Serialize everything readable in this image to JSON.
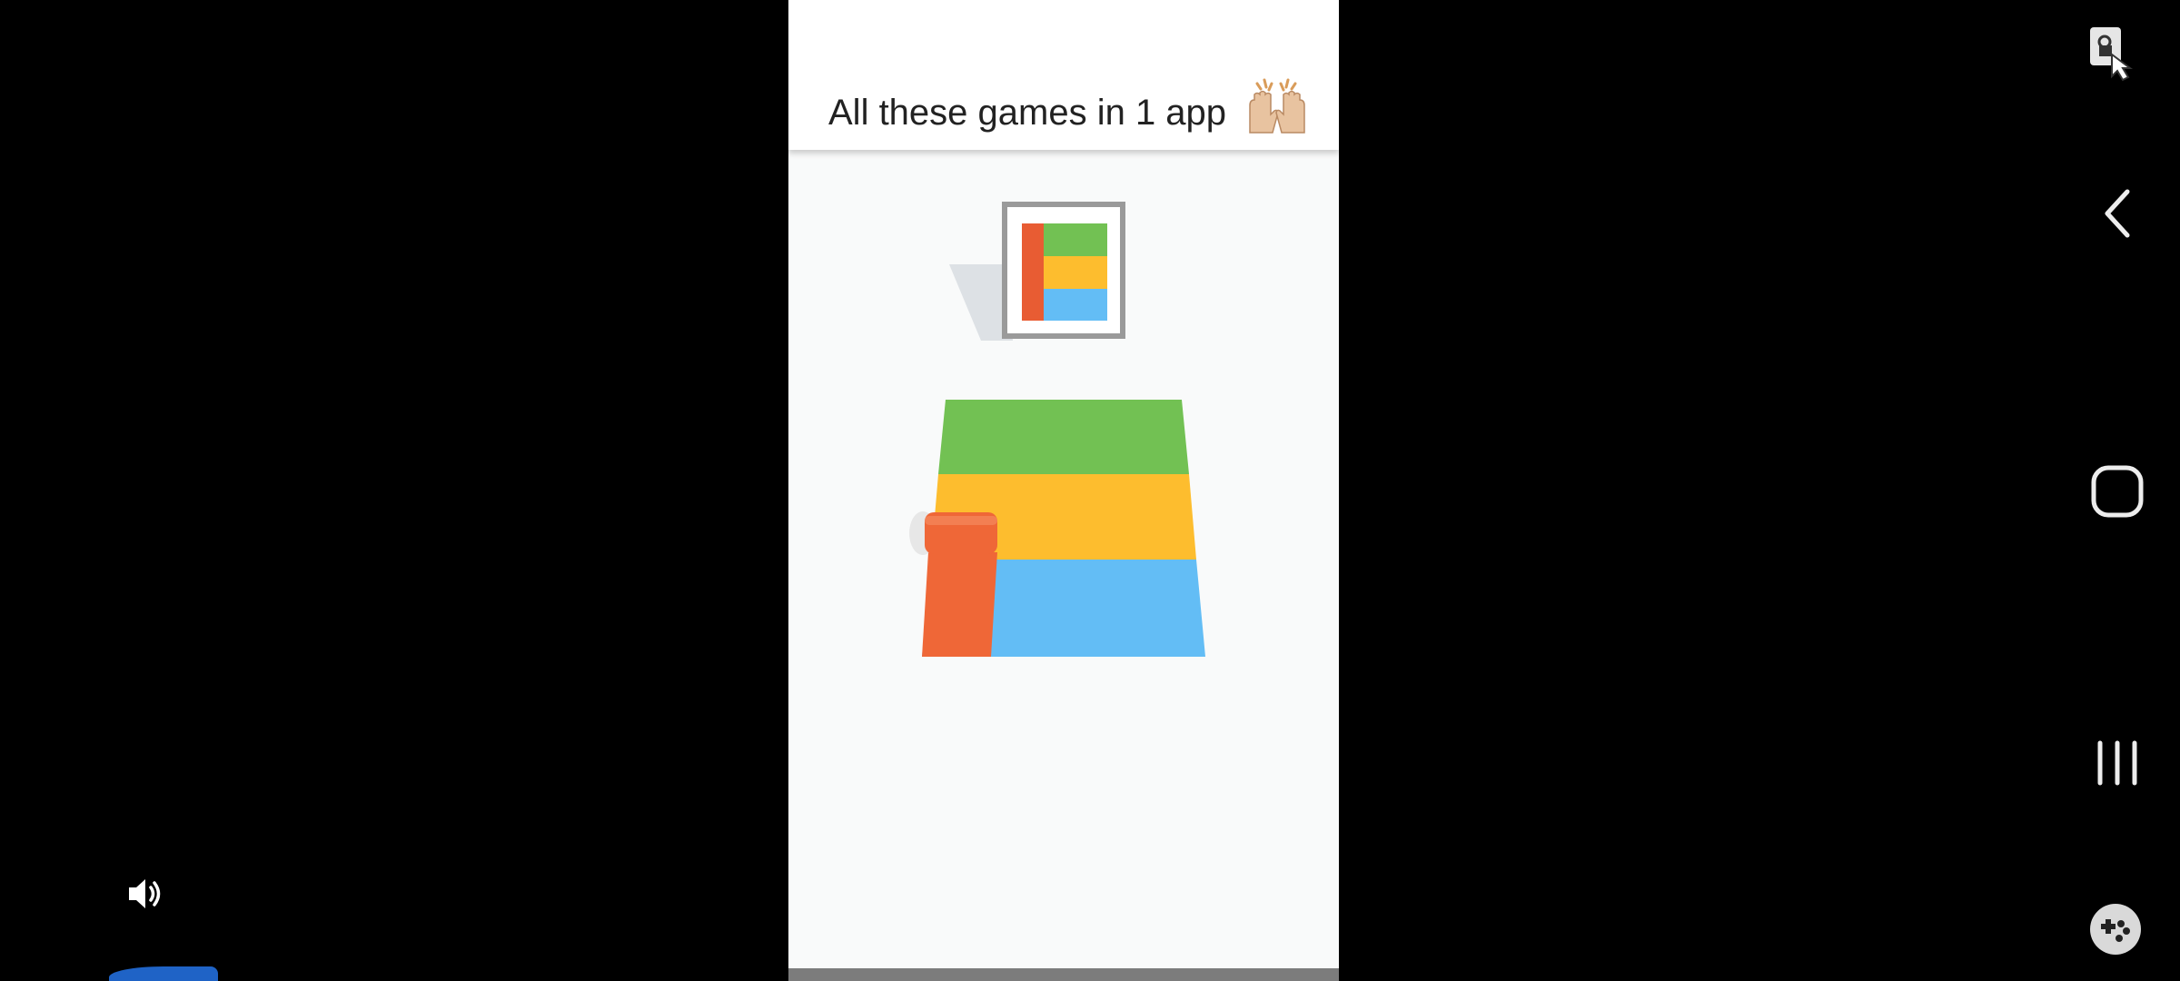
{
  "ad": {
    "title": "All these games in 1 app",
    "emoji_icon": "raising-hands-icon"
  },
  "game_preview": {
    "target_colors": [
      "#e85c33",
      "#72c153",
      "#fdbd2e",
      "#63bdf5"
    ],
    "roll_color": "#ef6737",
    "description_icons": [
      "target-picture-icon",
      "paint-roller-icon"
    ]
  },
  "system_nav": {
    "icons": [
      "screen-lock-touch-icon",
      "back-icon",
      "home-icon",
      "recents-icon",
      "game-launcher-icon"
    ]
  },
  "media": {
    "volume_icon": "volume-icon"
  }
}
